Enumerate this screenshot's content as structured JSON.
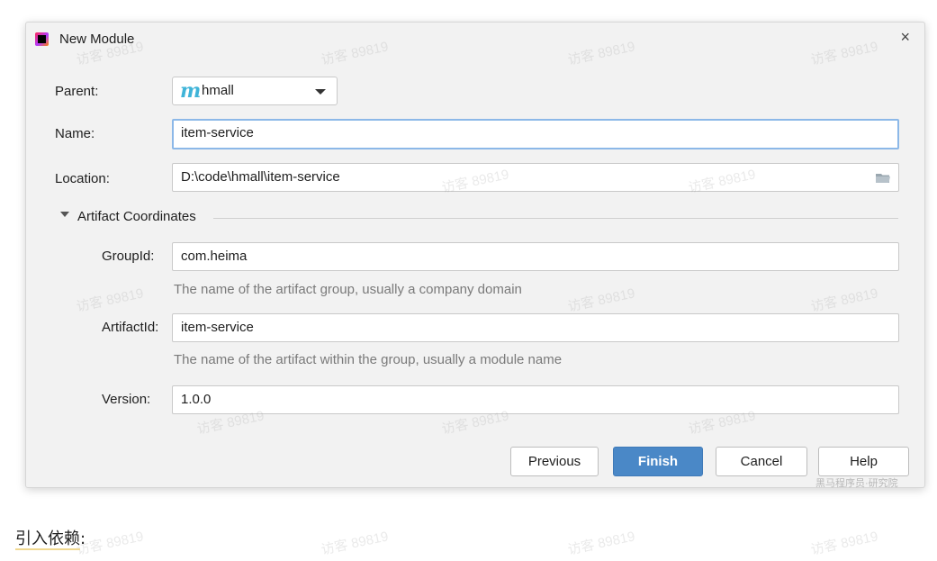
{
  "dialog": {
    "title": "New Module",
    "close_glyph": "×",
    "app_icon": "intellij-icon"
  },
  "form": {
    "parent": {
      "label": "Parent:",
      "value": "hmall",
      "icon": "maven-module-icon"
    },
    "name": {
      "label": "Name:",
      "value": "item-service"
    },
    "location": {
      "label": "Location:",
      "value": "D:\\code\\hmall\\item-service",
      "icon": "folder-icon"
    }
  },
  "artifact": {
    "section_title": "Artifact Coordinates",
    "group_id": {
      "label": "GroupId:",
      "value": "com.heima",
      "hint": "The name of the artifact group, usually a company domain"
    },
    "artifact_id": {
      "label": "ArtifactId:",
      "value": "item-service",
      "hint": "The name of the artifact within the group, usually a module name"
    },
    "version": {
      "label": "Version:",
      "value": "1.0.0"
    }
  },
  "buttons": {
    "previous": "Previous",
    "finish": "Finish",
    "cancel": "Cancel",
    "help": "Help"
  },
  "watermark": "访客 89819",
  "brand": "黑马程序员·研究院",
  "document": {
    "text": "引入依赖",
    "suffix": ":"
  },
  "colors": {
    "primary_button": "#4a88c7",
    "focus_border": "#8cb8e8",
    "dialog_bg": "#f2f2f2"
  }
}
